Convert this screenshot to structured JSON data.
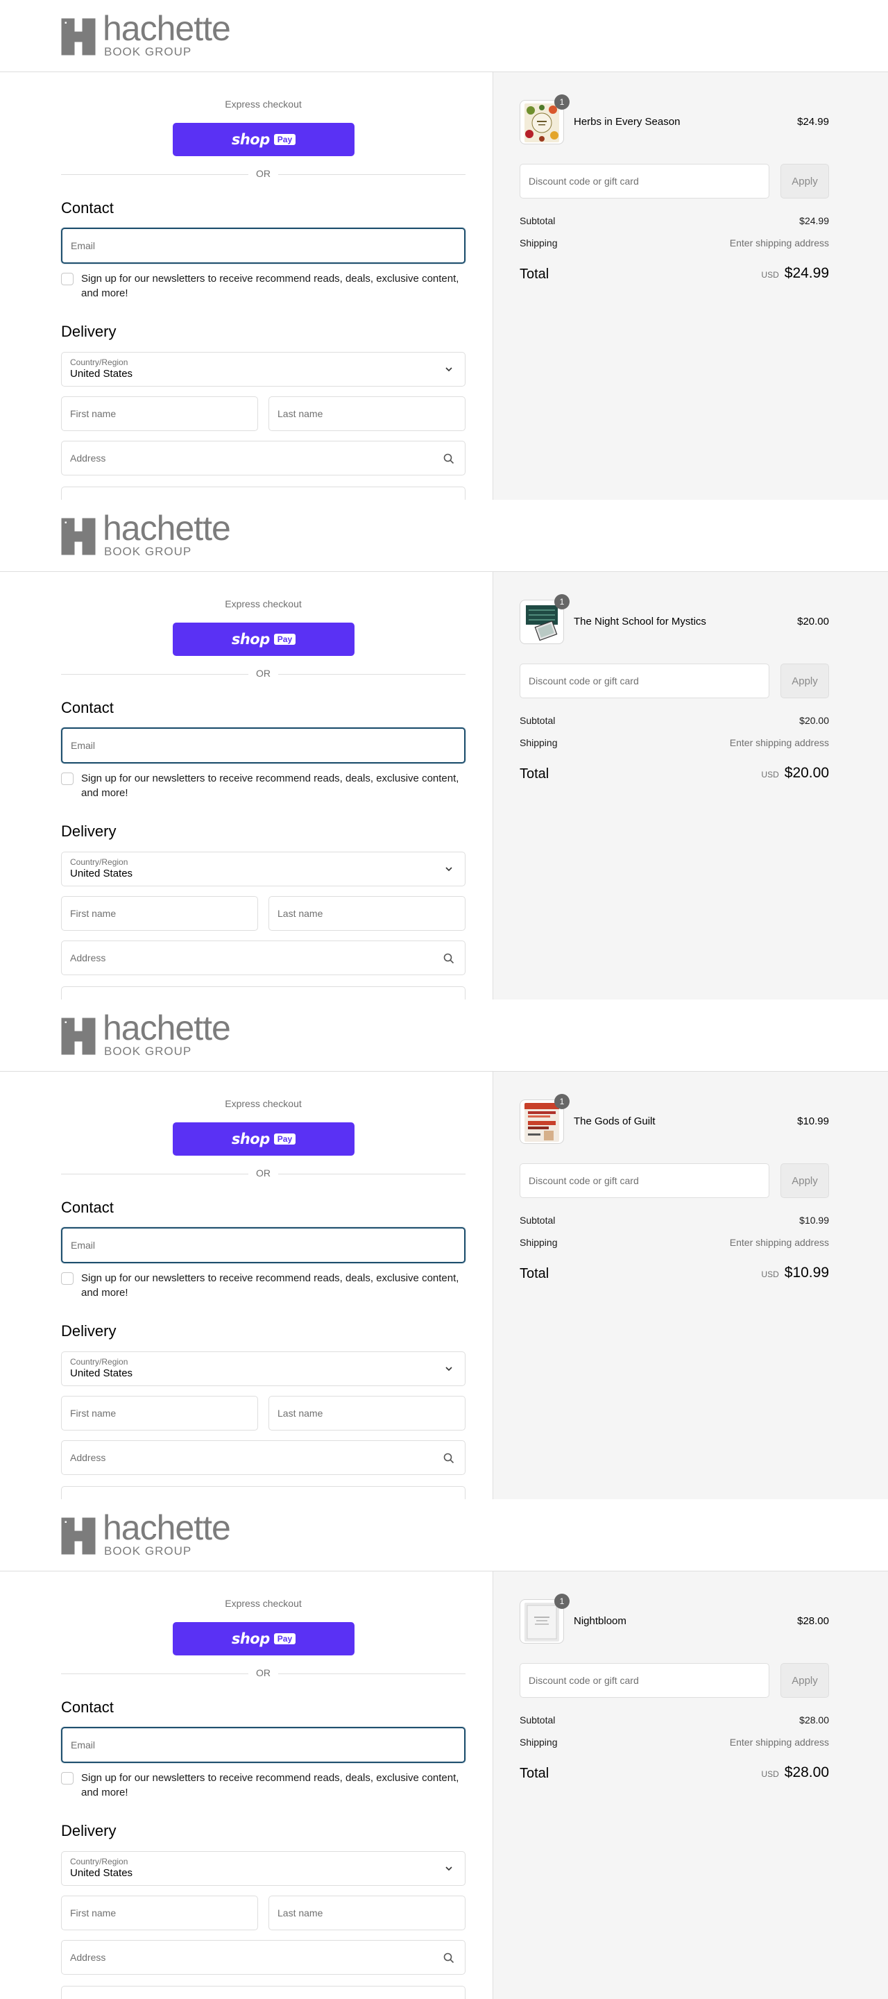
{
  "brand": {
    "name": "hachette",
    "sub": "BOOK GROUP"
  },
  "checkout": {
    "express_label": "Express checkout",
    "shop_label": "shop",
    "pay_label": "Pay",
    "or_label": "OR",
    "contact_heading": "Contact",
    "email_placeholder": "Email",
    "newsletter_label": "Sign up for our newsletters to receive recommend reads, deals, exclusive content, and more!",
    "delivery_heading": "Delivery",
    "country_label": "Country/Region",
    "country_value": "United States",
    "first_name_placeholder": "First name",
    "last_name_placeholder": "Last name",
    "address_placeholder": "Address"
  },
  "summary": {
    "discount_placeholder": "Discount code or gift card",
    "apply_label": "Apply",
    "subtotal_label": "Subtotal",
    "shipping_label": "Shipping",
    "shipping_value": "Enter shipping address",
    "total_label": "Total",
    "currency": "USD"
  },
  "orders": [
    {
      "title": "Herbs in Every Season",
      "price": "$24.99",
      "quantity": "1",
      "subtotal": "$24.99",
      "total": "$24.99",
      "cover": "herbs"
    },
    {
      "title": "The Night School for Mystics",
      "price": "$20.00",
      "quantity": "1",
      "subtotal": "$20.00",
      "total": "$20.00",
      "cover": "mystics"
    },
    {
      "title": "The Gods of Guilt",
      "price": "$10.99",
      "quantity": "1",
      "subtotal": "$10.99",
      "total": "$10.99",
      "cover": "guilt"
    },
    {
      "title": "Nightbloom",
      "price": "$28.00",
      "quantity": "1",
      "subtotal": "$28.00",
      "total": "$28.00",
      "cover": "nightbloom"
    }
  ]
}
